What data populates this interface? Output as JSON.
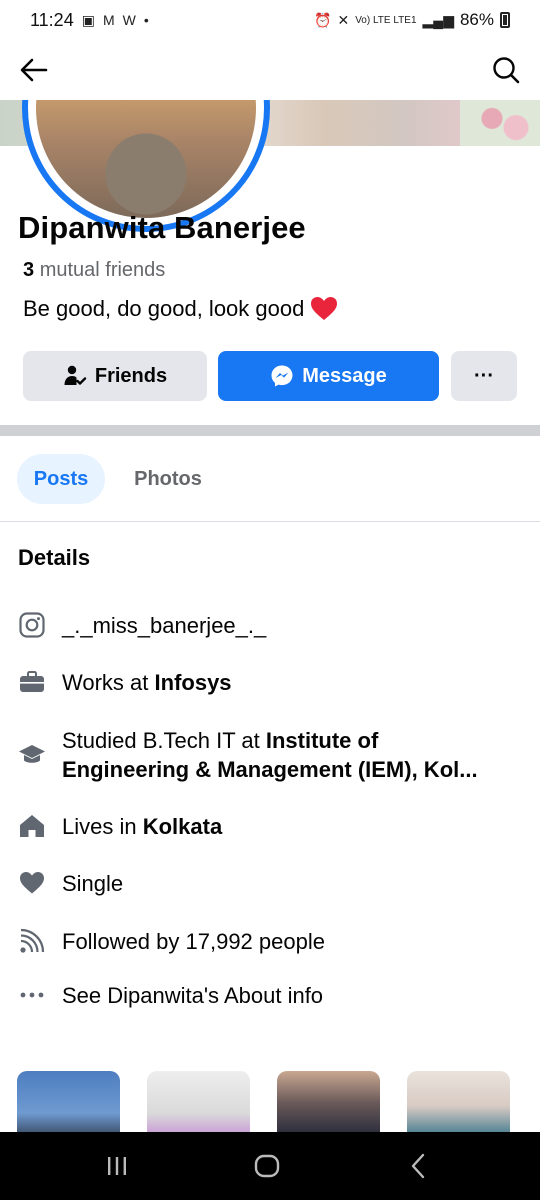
{
  "status_bar": {
    "time": "11:24",
    "left_icons": [
      "image-icon",
      "gmail-icon",
      "wish-icon",
      "dot"
    ],
    "network": "Vo) LTE LTE1",
    "battery": "86%"
  },
  "nav": {
    "back_icon": "arrow-left-icon",
    "search_icon": "search-icon"
  },
  "profile": {
    "name": "Dipanwita Banerjee",
    "mutual_count": "3",
    "mutual_label": "mutual friends",
    "bio": "Be good, do good, look good",
    "bio_emoji": "❤️"
  },
  "actions": {
    "friends_label": "Friends",
    "message_label": "Message",
    "more_label": "···"
  },
  "tabs": [
    {
      "label": "Posts",
      "active": true
    },
    {
      "label": "Photos",
      "active": false
    }
  ],
  "details": {
    "title": "Details",
    "instagram": "_._miss_banerjee_._",
    "work_prefix": "Works at",
    "work_place": "Infosys",
    "study_prefix": "Studied B.Tech IT at",
    "study_place_line1": "Institute of",
    "study_place_line2": "Engineering & Management (IEM), Kol...",
    "lives_prefix": "Lives in",
    "lives_place": "Kolkata",
    "relationship": "Single",
    "followers": "Followed by 17,992 people",
    "about_link": "See Dipanwita's About info"
  },
  "colors": {
    "accent": "#1877f2",
    "secondary_btn": "#e4e6eb",
    "muted_text": "#65676b",
    "icon_gray": "#606770"
  }
}
